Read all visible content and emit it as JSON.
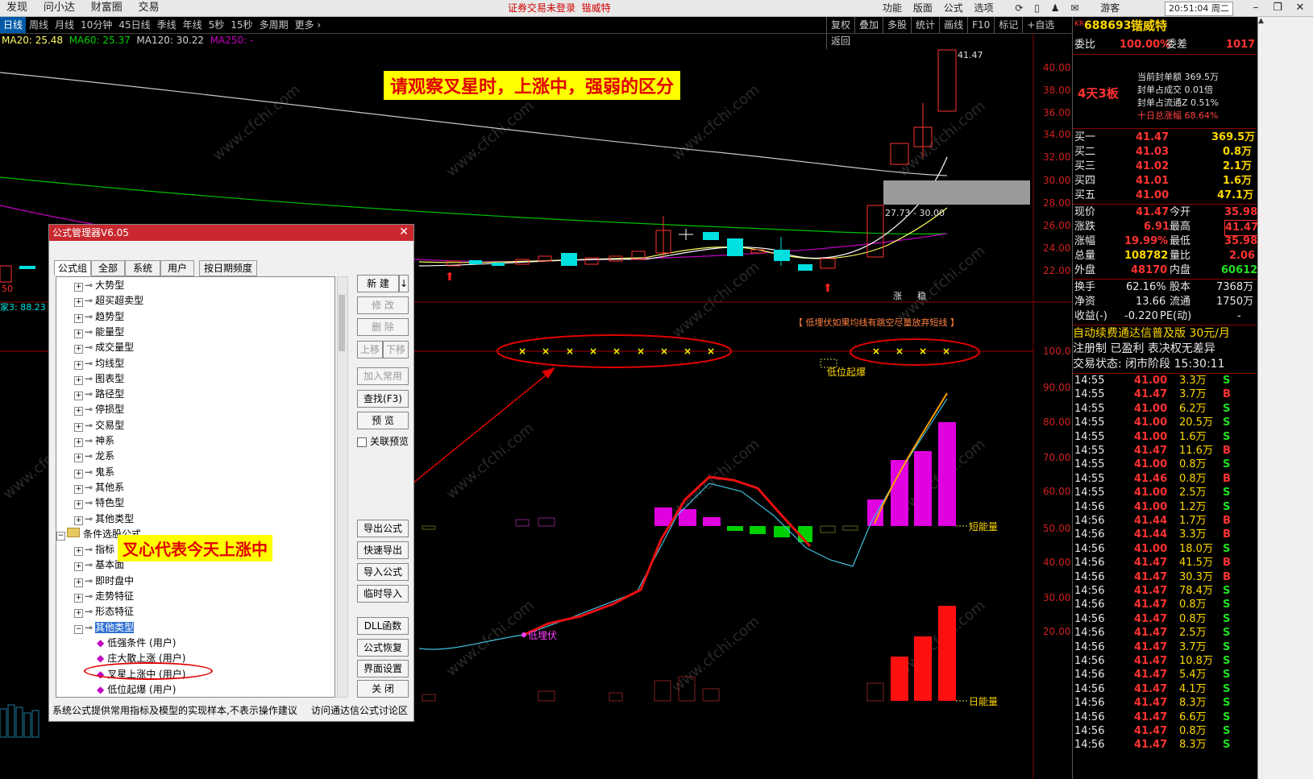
{
  "topbar": {
    "menu": [
      "发现",
      "问小达",
      "财富圈",
      "交易"
    ],
    "alert": "证券交易未登录",
    "alert_stock": "锴威特",
    "right_items": [
      "功能",
      "版面",
      "公式",
      "选项"
    ],
    "user": "游客",
    "clock": "20:51:04 周二",
    "win_buttons": [
      "–",
      "❐",
      "✕"
    ]
  },
  "periodbar": {
    "items": [
      "日线",
      "周线",
      "月线",
      "10分钟",
      "45日线",
      "季线",
      "年线",
      "5秒",
      "15秒",
      "多周期",
      "更多 ›"
    ],
    "tools": [
      "复权",
      "叠加",
      "多股",
      "统计",
      "画线",
      "F10",
      "标记",
      "+自选",
      "返回"
    ]
  },
  "ma_line": {
    "ma20": "MA20: 25.48",
    "ma60": "MA60: 25.37",
    "ma120": "MA120: 30.22",
    "ma250": "MA250: -"
  },
  "chart_data": {
    "type": "candlestick",
    "title": "请观察叉星时，上涨中，强弱的区分",
    "price_axis": [
      "40.00",
      "38.00",
      "36.00",
      "34.00",
      "32.00",
      "30.00",
      "28.00",
      "26.00",
      "24.00",
      "22.00"
    ],
    "indicator_axis": [
      "100.0",
      "90.00",
      "80.00",
      "70.00",
      "60.00",
      "50.00",
      "40.00",
      "30.00",
      "20.00"
    ],
    "high_label": "41.47",
    "gap_label": "27.73 - 30.00",
    "notice": "【 低埋伏如果均线有跳空尽量放弃短线 】",
    "labels": {
      "low_ambush": "低埋伏",
      "low_breakout": "低位起爆",
      "short_energy": "短能量",
      "day_energy": "日能量",
      "zhang": "涨",
      "stable": "稳",
      "left_price": "50",
      "left_ind": "家3: 88.23"
    }
  },
  "right_panel": {
    "code_prefix": "KR",
    "code": "688693",
    "name": "锴威特",
    "weibi_label": "委比",
    "weibi_val": "100.00%",
    "weicha_label": "委差",
    "weicha_val": "1017",
    "ban": "4天3板",
    "seal": [
      "当前封单额 369.5万",
      "封单占成交 0.01倍",
      "封单占流通Z 0.51%",
      "十日总涨幅 68.64%"
    ],
    "buy": [
      {
        "label": "买一",
        "price": "41.47",
        "vol": "369.5万"
      },
      {
        "label": "买二",
        "price": "41.03",
        "vol": "0.8万"
      },
      {
        "label": "买三",
        "price": "41.02",
        "vol": "2.1万"
      },
      {
        "label": "买四",
        "price": "41.01",
        "vol": "1.6万"
      },
      {
        "label": "买五",
        "price": "41.00",
        "vol": "47.1万"
      }
    ],
    "quote": [
      {
        "l1": "现价",
        "v1": "41.47",
        "l2": "今开",
        "v2": "35.98"
      },
      {
        "l1": "涨跌",
        "v1": "6.91",
        "l2": "最高",
        "v2": "41.47"
      },
      {
        "l1": "涨幅",
        "v1": "19.99%",
        "l2": "最低",
        "v2": "35.98"
      },
      {
        "l1": "总量",
        "v1": "108782",
        "l2": "量比",
        "v2": "2.06"
      },
      {
        "l1": "外盘",
        "v1": "48170",
        "l2": "内盘",
        "v2": "60612"
      }
    ],
    "stats": [
      {
        "l1": "换手",
        "v1": "62.16%",
        "l2": "股本",
        "v2": "7368万"
      },
      {
        "l1": "净资",
        "v1": "13.66",
        "l2": "流通",
        "v2": "1750万"
      },
      {
        "l1": "收益(-)",
        "v1": "-0.220",
        "l2": "PE(动)",
        "v2": "-"
      }
    ],
    "ad": "自动续费通达信普及版  30元/月",
    "reg": "注册制 已盈利 表决权无差异",
    "trade_status": "交易状态: 闭市阶段  15:30:11",
    "ticks": [
      {
        "t": "14:55",
        "p": "41.00",
        "v": "3.3万",
        "s": "S"
      },
      {
        "t": "14:55",
        "p": "41.47",
        "v": "3.7万",
        "s": "B"
      },
      {
        "t": "14:55",
        "p": "41.00",
        "v": "6.2万",
        "s": "S"
      },
      {
        "t": "14:55",
        "p": "41.00",
        "v": "20.5万",
        "s": "S"
      },
      {
        "t": "14:55",
        "p": "41.00",
        "v": "1.6万",
        "s": "S"
      },
      {
        "t": "14:55",
        "p": "41.47",
        "v": "11.6万",
        "s": "B"
      },
      {
        "t": "14:55",
        "p": "41.00",
        "v": "0.8万",
        "s": "S"
      },
      {
        "t": "14:55",
        "p": "41.46",
        "v": "0.8万",
        "s": "B"
      },
      {
        "t": "14:55",
        "p": "41.00",
        "v": "2.5万",
        "s": "S"
      },
      {
        "t": "14:56",
        "p": "41.00",
        "v": "1.2万",
        "s": "S"
      },
      {
        "t": "14:56",
        "p": "41.44",
        "v": "1.7万",
        "s": "B"
      },
      {
        "t": "14:56",
        "p": "41.44",
        "v": "3.3万",
        "s": "B"
      },
      {
        "t": "14:56",
        "p": "41.00",
        "v": "18.0万",
        "s": "S"
      },
      {
        "t": "14:56",
        "p": "41.47",
        "v": "41.5万",
        "s": "B"
      },
      {
        "t": "14:56",
        "p": "41.47",
        "v": "30.3万",
        "s": "B"
      },
      {
        "t": "14:56",
        "p": "41.47",
        "v": "78.4万",
        "s": "S"
      },
      {
        "t": "14:56",
        "p": "41.47",
        "v": "0.8万",
        "s": "S"
      },
      {
        "t": "14:56",
        "p": "41.47",
        "v": "0.8万",
        "s": "S"
      },
      {
        "t": "14:56",
        "p": "41.47",
        "v": "2.5万",
        "s": "S"
      },
      {
        "t": "14:56",
        "p": "41.47",
        "v": "3.7万",
        "s": "S"
      },
      {
        "t": "14:56",
        "p": "41.47",
        "v": "10.8万",
        "s": "S"
      },
      {
        "t": "14:56",
        "p": "41.47",
        "v": "5.4万",
        "s": "S"
      },
      {
        "t": "14:56",
        "p": "41.47",
        "v": "4.1万",
        "s": "S"
      },
      {
        "t": "14:56",
        "p": "41.47",
        "v": "8.3万",
        "s": "S"
      },
      {
        "t": "14:56",
        "p": "41.47",
        "v": "6.6万",
        "s": "S"
      },
      {
        "t": "14:56",
        "p": "41.47",
        "v": "0.8万",
        "s": "S"
      },
      {
        "t": "14:56",
        "p": "41.47",
        "v": "8.3万",
        "s": "S"
      }
    ]
  },
  "dialog": {
    "title": "公式管理器V6.05",
    "close": "✕",
    "tabs": [
      "公式组",
      "全部",
      "系统",
      "用户",
      "按日期频度"
    ],
    "tree": [
      {
        "label": "大势型",
        "level": 1
      },
      {
        "label": "超买超卖型",
        "level": 1
      },
      {
        "label": "趋势型",
        "level": 1
      },
      {
        "label": "能量型",
        "level": 1
      },
      {
        "label": "成交量型",
        "level": 1
      },
      {
        "label": "均线型",
        "level": 1
      },
      {
        "label": "图表型",
        "level": 1
      },
      {
        "label": "路径型",
        "level": 1
      },
      {
        "label": "停损型",
        "level": 1
      },
      {
        "label": "交易型",
        "level": 1
      },
      {
        "label": "神系",
        "level": 1
      },
      {
        "label": "龙系",
        "level": 1
      },
      {
        "label": "鬼系",
        "level": 1
      },
      {
        "label": "其他系",
        "level": 1
      },
      {
        "label": "特色型",
        "level": 1
      },
      {
        "label": "其他类型",
        "level": 1
      },
      {
        "label": "条件选股公式",
        "level": 0
      },
      {
        "label": "指标",
        "level": 1
      },
      {
        "label": "基本面",
        "level": 1
      },
      {
        "label": "即时盘中",
        "level": 1
      },
      {
        "label": "走势特征",
        "level": 1
      },
      {
        "label": "形态特征",
        "level": 1
      },
      {
        "label": "其他类型",
        "level": 1
      },
      {
        "label": "低强条件  (用户)",
        "level": 2
      },
      {
        "label": "庄大散上涨  (用户)",
        "level": 2
      },
      {
        "label": "叉星上涨中  (用户)",
        "level": 2
      },
      {
        "label": "低位起爆  (用户)",
        "level": 2
      }
    ],
    "buttons": [
      "新  建",
      "修  改",
      "删  除",
      "上移",
      "下移",
      "加入常用",
      "查找(F3)",
      "预  览",
      "导出公式",
      "快速导出",
      "导入公式",
      "临时导入",
      "DLL函数",
      "公式恢复",
      "界面设置",
      "关  闭"
    ],
    "checkbox": "关联预览",
    "footer_left": "系统公式提供常用指标及模型的实现样本,不表示操作建议",
    "footer_right": "访问通达信公式讨论区"
  },
  "annotations": {
    "title_box": "请观察叉星时，上涨中，强弱的区分",
    "cross_box": "叉心代表今天上涨中"
  },
  "colors": {
    "up": "#ff3232",
    "down": "#00e0e0",
    "ma20": "#ffff60",
    "ma60": "#00c000",
    "ma120": "#c8c8c8",
    "ma250": "#c000c0",
    "accent_red": "#c8282e"
  }
}
